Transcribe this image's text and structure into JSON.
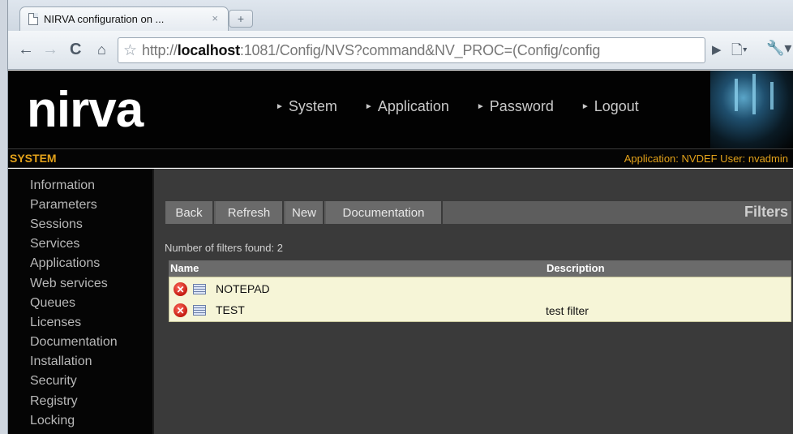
{
  "browser": {
    "tab_title": "NIRVA configuration on ...",
    "tab_close": "×",
    "new_tab": "+",
    "url_prefix": "http://",
    "url_host": "localhost",
    "url_rest": ":1081/Config/NVS?command&NV_PROC=(Config/config",
    "icons": [
      "back-icon",
      "forward-icon",
      "reload-icon",
      "home-icon",
      "star-icon",
      "go-icon",
      "page-menu-icon",
      "wrench-icon"
    ]
  },
  "header": {
    "logo": "nirva",
    "nav": [
      {
        "label": "System"
      },
      {
        "label": "Application"
      },
      {
        "label": "Password"
      },
      {
        "label": "Logout"
      }
    ]
  },
  "section": {
    "title": "SYSTEM",
    "info": "Application: NVDEF  User: nvadmin"
  },
  "sidebar": {
    "items": [
      {
        "label": "Information"
      },
      {
        "label": "Parameters"
      },
      {
        "label": "Sessions"
      },
      {
        "label": "Services"
      },
      {
        "label": "Applications"
      },
      {
        "label": "Web services"
      },
      {
        "label": "Queues"
      },
      {
        "label": "Licenses"
      },
      {
        "label": "Documentation"
      },
      {
        "label": "Installation"
      },
      {
        "label": "Security"
      },
      {
        "label": "Registry"
      },
      {
        "label": "Locking"
      }
    ]
  },
  "main": {
    "buttons": [
      {
        "label": "Back"
      },
      {
        "label": "Refresh"
      },
      {
        "label": "New"
      },
      {
        "label": "Documentation"
      }
    ],
    "title": "Filters",
    "count_text": "Number of filters found: 2",
    "columns": [
      "Name",
      "Description"
    ],
    "rows": [
      {
        "name": "NOTEPAD",
        "description": ""
      },
      {
        "name": "TEST",
        "description": "test filter"
      }
    ]
  },
  "colors": {
    "accent": "#e3a21a",
    "table_bg": "#f6f5d7",
    "panel_bg": "#3a3a3a"
  }
}
